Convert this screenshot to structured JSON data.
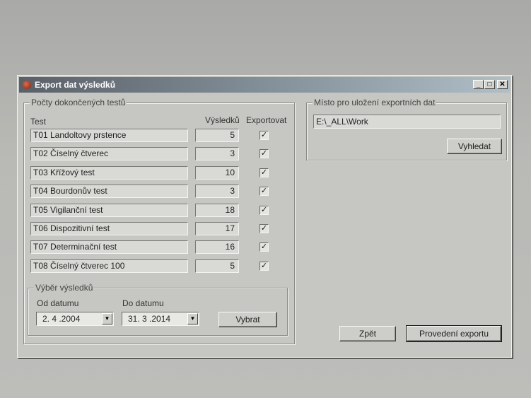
{
  "window": {
    "title": "Export dat výsledků",
    "min": "_",
    "max": "□",
    "close": "✕"
  },
  "tests_group": {
    "legend": "Počty dokončených testů",
    "col_test": "Test",
    "col_results": "Výsledků",
    "col_export": "Exportovat",
    "rows": [
      {
        "name": "T01 Landoltovy prstence",
        "count": "5",
        "export": true
      },
      {
        "name": "T02 Číselný čtverec",
        "count": "3",
        "export": true
      },
      {
        "name": "T03 Křížový test",
        "count": "10",
        "export": true
      },
      {
        "name": "T04 Bourdonův test",
        "count": "3",
        "export": true
      },
      {
        "name": "T05 Vigilanční test",
        "count": "18",
        "export": true
      },
      {
        "name": "T06 Dispozitivní test",
        "count": "17",
        "export": true
      },
      {
        "name": "T07 Determinační test",
        "count": "16",
        "export": true
      },
      {
        "name": "T08 Číselný čtverec 100",
        "count": "5",
        "export": true
      }
    ]
  },
  "selection_group": {
    "legend": "Výběr výsledků",
    "from_label": "Od datumu",
    "from_value": "2. 4 .2004",
    "to_label": "Do datumu",
    "to_value": "31. 3 .2014",
    "select_button": "Vybrat"
  },
  "location_group": {
    "legend": "Místo pro uložení exportních dat",
    "path": "E:\\_ALL\\Work",
    "browse_button": "Vyhledat"
  },
  "buttons": {
    "back": "Zpět",
    "export": "Provedení exportu"
  },
  "icons": {
    "checkbox": "✓",
    "dropdown": "▼"
  }
}
